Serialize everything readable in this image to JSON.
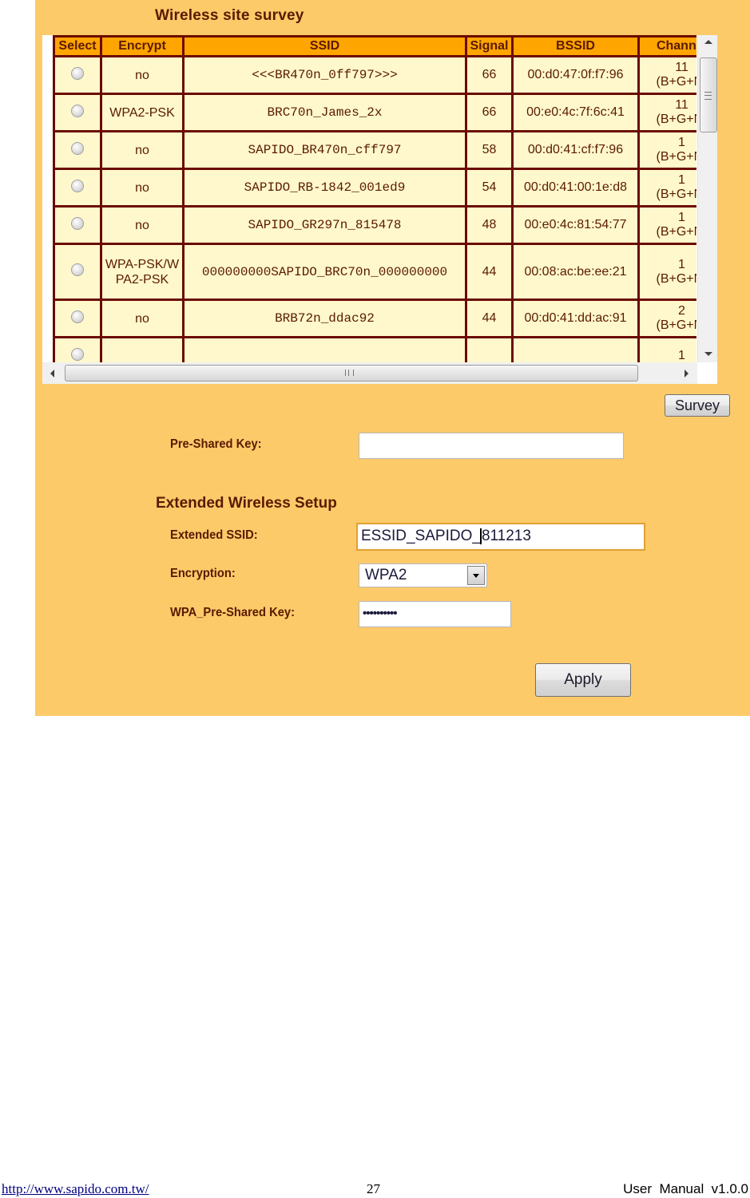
{
  "survey": {
    "title": "Wireless site survey",
    "columns": [
      "Select",
      "Encrypt",
      "SSID",
      "Signal",
      "BSSID",
      "Channel"
    ],
    "rows": [
      {
        "encrypt": "no",
        "ssid": "<<<BR470n_0ff797>>>",
        "signal": "66",
        "bssid": "00:d0:47:0f:f7:96",
        "channel": "11",
        "mode": "(B+G+N)"
      },
      {
        "encrypt": "WPA2-PSK",
        "ssid": "BRC70n_James_2x",
        "signal": "66",
        "bssid": "00:e0:4c:7f:6c:41",
        "channel": "11",
        "mode": "(B+G+N)"
      },
      {
        "encrypt": "no",
        "ssid": "SAPIDO_BR470n_cff797",
        "signal": "58",
        "bssid": "00:d0:41:cf:f7:96",
        "channel": "1",
        "mode": "(B+G+N)"
      },
      {
        "encrypt": "no",
        "ssid": "SAPIDO_RB-1842_001ed9",
        "signal": "54",
        "bssid": "00:d0:41:00:1e:d8",
        "channel": "1",
        "mode": "(B+G+N)"
      },
      {
        "encrypt": "no",
        "ssid": "SAPIDO_GR297n_815478",
        "signal": "48",
        "bssid": "00:e0:4c:81:54:77",
        "channel": "1",
        "mode": "(B+G+N)"
      },
      {
        "encrypt": "WPA-PSK/WPA2-PSK",
        "ssid": "000000000SAPIDO_BRC70n_000000000",
        "signal": "44",
        "bssid": "00:08:ac:be:ee:21",
        "channel": "1",
        "mode": "(B+G+N)"
      },
      {
        "encrypt": "no",
        "ssid": "BRB72n_ddac92",
        "signal": "44",
        "bssid": "00:d0:41:dd:ac:91",
        "channel": "2",
        "mode": "(B+G+N)"
      },
      {
        "encrypt": "",
        "ssid": "",
        "signal": "",
        "bssid": "",
        "channel": "1",
        "mode": ""
      }
    ],
    "survey_button": "Survey"
  },
  "psk": {
    "label": "Pre-Shared Key:",
    "value": ""
  },
  "extended": {
    "title": "Extended Wireless Setup",
    "ssid_label": "Extended SSID:",
    "ssid_before_caret": "ESSID_SAPIDO_",
    "ssid_after_caret": "811213",
    "encryption_label": "Encryption:",
    "encryption_value": "WPA2",
    "wpa_key_label": "WPA_Pre-Shared Key:",
    "wpa_key_masked": "••••••••••",
    "apply_button": "Apply"
  },
  "footer": {
    "url": "http://www.sapido.com.tw/",
    "page": "27",
    "version": "User  Manual  v1.0.0"
  }
}
